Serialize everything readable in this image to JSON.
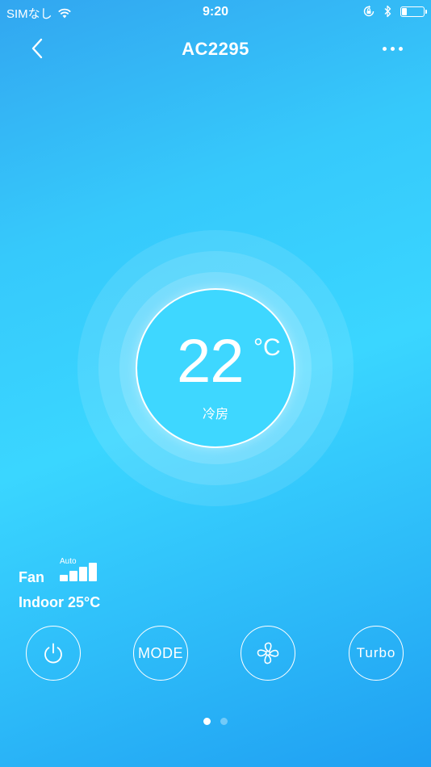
{
  "status_bar": {
    "carrier": "SIMなし",
    "time": "9:20",
    "battery_level_percent": 25
  },
  "header": {
    "title": "AC2295",
    "back_icon": "chevron-left-icon",
    "more_icon": "ellipsis-icon"
  },
  "dial": {
    "temperature": "22",
    "unit": "°C",
    "mode": "冷房"
  },
  "info": {
    "fan_label": "Fan",
    "fan_speed_label": "Auto",
    "fan_level": 3,
    "fan_levels": 4,
    "indoor": "Indoor 25°C"
  },
  "controls": {
    "power_icon": "power-icon",
    "mode_label": "MODE",
    "fan_icon": "fan-icon",
    "turbo_label": "Turbo"
  },
  "pager": {
    "pages": 2,
    "current": 1
  },
  "colors": {
    "background_light": "#3ad6ff",
    "background_dark": "#1f9ff2",
    "dial_fill": "#3ed7ff",
    "foreground": "#ffffff"
  }
}
